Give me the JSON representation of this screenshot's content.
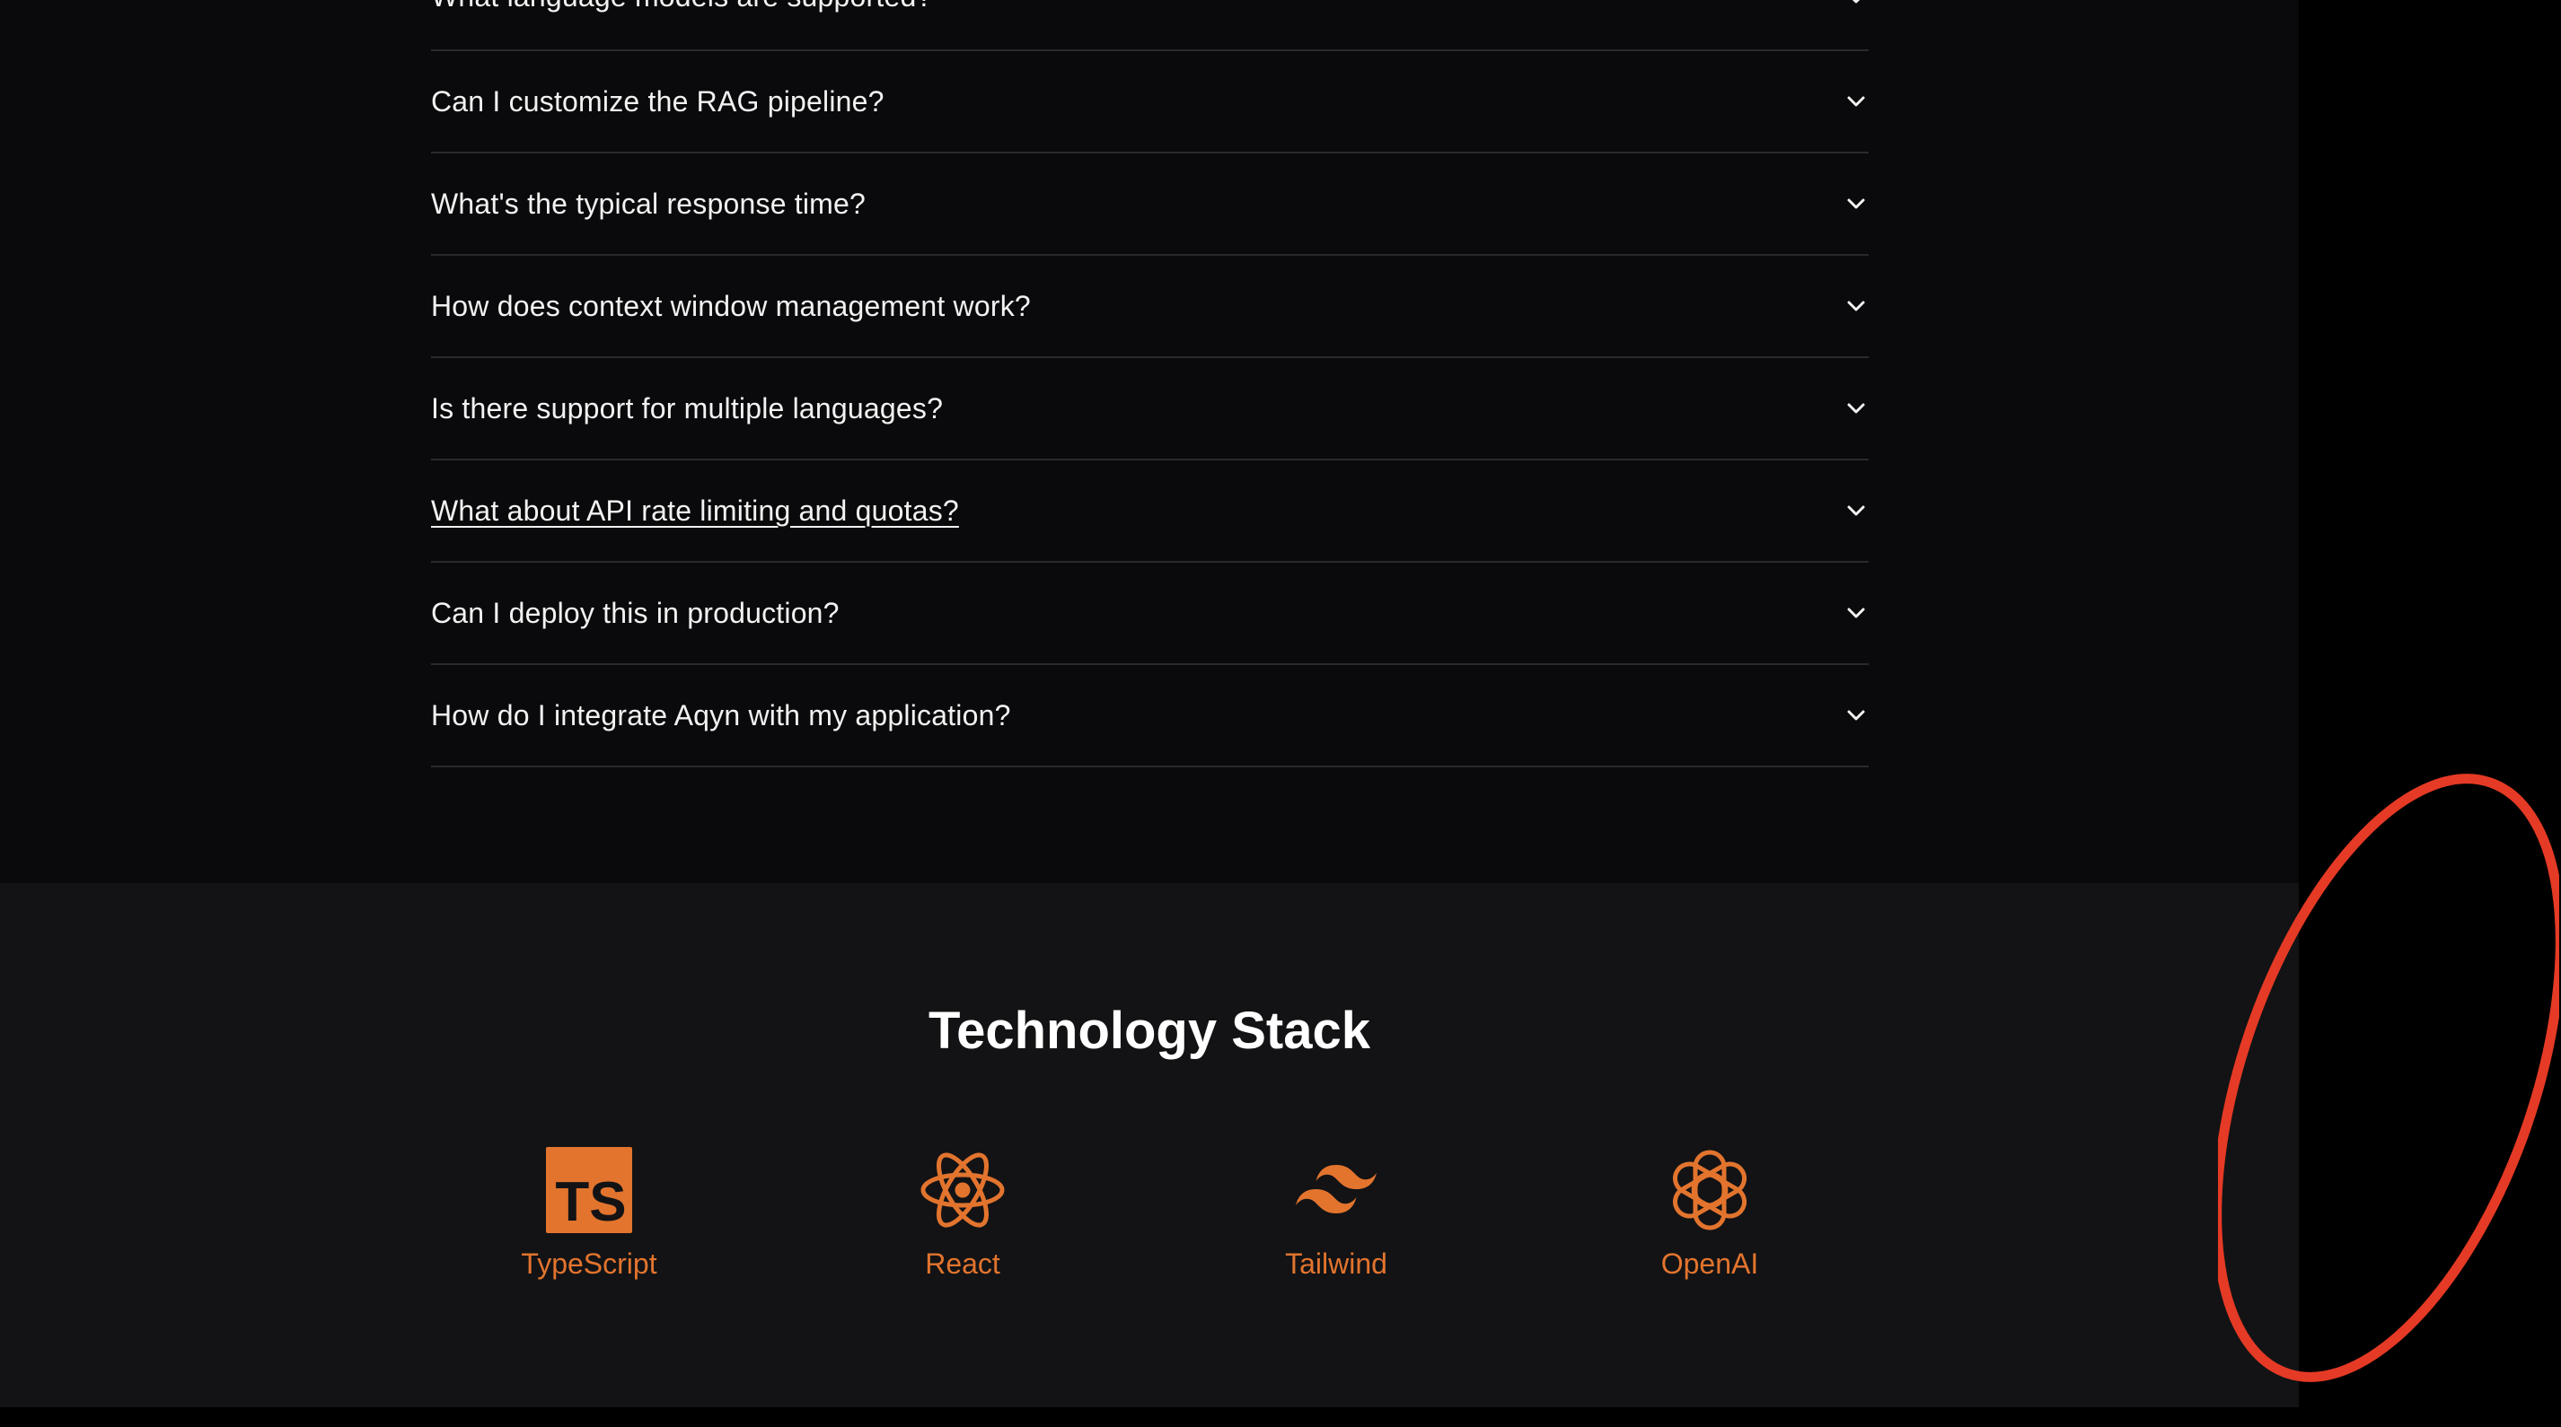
{
  "faq": {
    "items": [
      {
        "question": "What language models are supported?"
      },
      {
        "question": "Can I customize the RAG pipeline?"
      },
      {
        "question": "What's the typical response time?"
      },
      {
        "question": "How does context window management work?"
      },
      {
        "question": "Is there support for multiple languages?"
      },
      {
        "question": "What about API rate limiting and quotas?"
      },
      {
        "question": "Can I deploy this in production?"
      },
      {
        "question": "How do I integrate Aqyn with my application?"
      }
    ],
    "chevron_icon": "chevron-down-icon"
  },
  "tech": {
    "title": "Technology Stack",
    "items": [
      {
        "label": "TypeScript",
        "icon": "typescript-icon"
      },
      {
        "label": "React",
        "icon": "react-icon"
      },
      {
        "label": "Tailwind",
        "icon": "tailwind-icon"
      },
      {
        "label": "OpenAI",
        "icon": "openai-icon"
      }
    ],
    "accent_color": "#e2742e"
  },
  "colors": {
    "background": "#0a0a0c",
    "panel": "#131315",
    "divider": "#2a2a2e",
    "annotation": "#e53a25"
  }
}
